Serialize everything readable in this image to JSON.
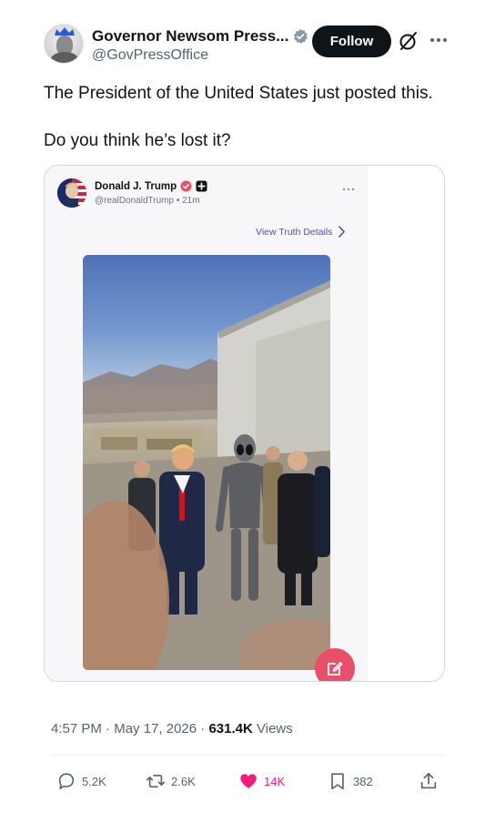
{
  "tweet": {
    "author_name": "Governor Newsom Press...",
    "author_handle": "@GovPressOffice",
    "follow_label": "Follow",
    "text_line1": "The President of the United States just posted this.",
    "text_line2": "Do you think he’s lost it?",
    "time": "4:57 PM",
    "date": "May 17, 2026",
    "sep": "·",
    "views_count": "631.4K",
    "views_label": "Views"
  },
  "embedded_post": {
    "author_name": "Donald J. Trump",
    "author_handle": "@realDonaldTrump",
    "time_ago": "21m",
    "view_details_label": "View Truth Details"
  },
  "actions": {
    "replies": "5.2K",
    "reposts": "2.6K",
    "likes": "14K",
    "bookmarks": "382"
  },
  "icons": {
    "verified": "verified-badge-icon",
    "grok": "grok-icon",
    "more": "more-icon",
    "reply": "reply-icon",
    "repost": "repost-icon",
    "like": "heart-icon",
    "bookmark": "bookmark-icon",
    "share": "share-icon",
    "compose": "compose-icon"
  },
  "colors": {
    "verified_blue": "#1d9bf0",
    "like_pink": "#f91880",
    "truth_verified_red": "#e8506a",
    "follow_bg": "#0f1419"
  }
}
